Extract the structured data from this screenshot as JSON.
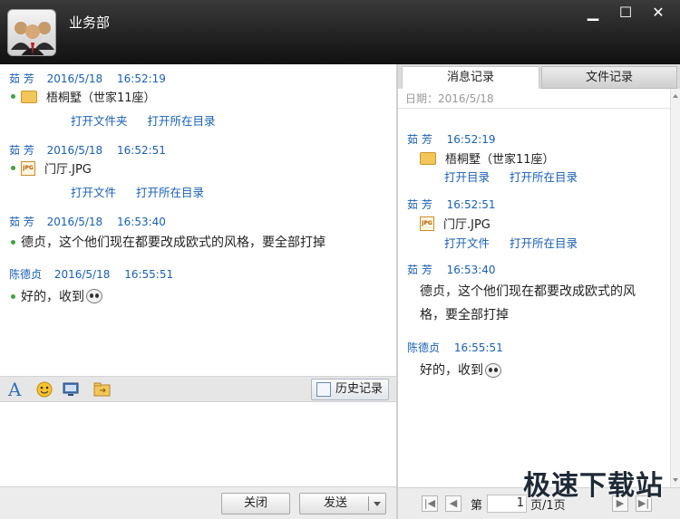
{
  "window": {
    "title": "业务部",
    "minimize": "▁",
    "maximize": "☐",
    "close": "✕"
  },
  "chat": {
    "messages": [
      {
        "sender": "茹 芳",
        "date": "2016/5/18",
        "time": "16:52:19",
        "file": "梧桐墅（世家11座）",
        "file_icon": "folder-icon",
        "links": [
          "打开文件夹",
          "打开所在目录"
        ]
      },
      {
        "sender": "茹 芳",
        "date": "2016/5/18",
        "time": "16:52:51",
        "file": "门厅.JPG",
        "file_icon": "jpg-icon",
        "links": [
          "打开文件",
          "打开所在目录"
        ]
      },
      {
        "sender": "茹 芳",
        "date": "2016/5/18",
        "time": "16:53:40",
        "text": "德贞，这个他们现在都要改成欧式的风格，要全部打掉"
      },
      {
        "sender": "陈德贞",
        "date": "2016/5/18",
        "time": "16:55:51",
        "text": "好的，收到"
      }
    ]
  },
  "toolbar": {
    "font_icon": "A",
    "history_label": "历史记录"
  },
  "buttons": {
    "close": "关闭",
    "send": "发送"
  },
  "history": {
    "tabs": [
      "消息记录",
      "文件记录"
    ],
    "date_label": "日期：2016/5/18",
    "entries": [
      {
        "sender": "茹 芳",
        "time": "16:52:19",
        "file": "梧桐墅（世家11座）",
        "links": [
          "打开目录",
          "打开所在目录"
        ]
      },
      {
        "sender": "茹 芳",
        "time": "16:52:51",
        "file": "门厅.JPG",
        "links": [
          "打开文件",
          "打开所在目录"
        ]
      },
      {
        "sender": "茹 芳",
        "time": "16:53:40",
        "text": "德贞，这个他们现在都要改成欧式的风格，要全部打掉"
      },
      {
        "sender": "陈德贞",
        "time": "16:55:51",
        "text": "好的，收到"
      }
    ],
    "pager": {
      "prefix": "第",
      "page": "1",
      "total": "页/1页",
      "first": "|◀",
      "prev": "◀",
      "next": "▶",
      "last": "▶|"
    }
  },
  "watermark": "极速下载站",
  "colors": {
    "link": "#1a5fb4",
    "titlebar": "#1a1a1a"
  }
}
